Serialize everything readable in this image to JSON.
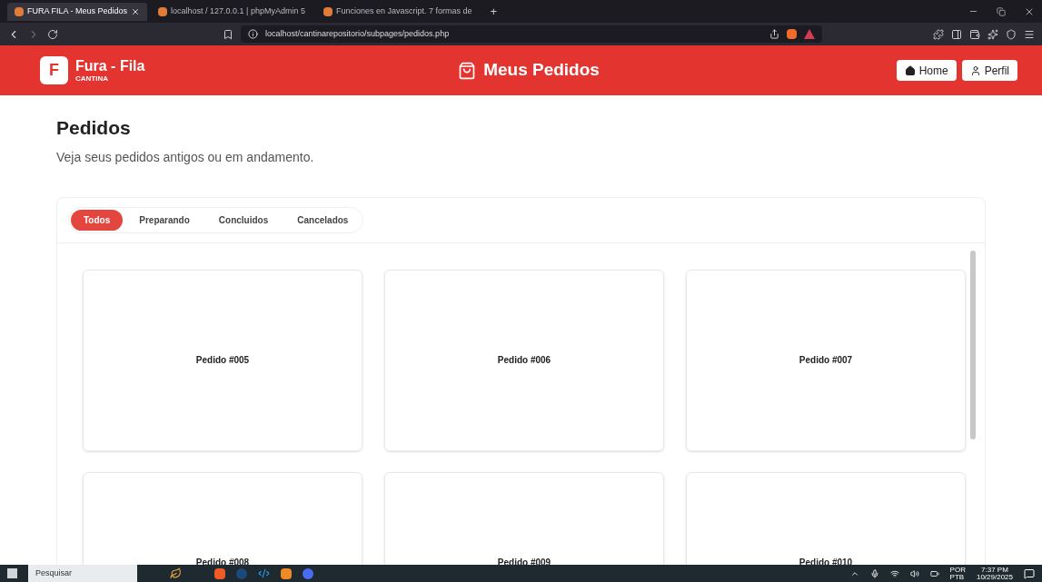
{
  "browser": {
    "tabs": [
      {
        "title": "FURA FILA - Meus Pedidos",
        "selected": true
      },
      {
        "title": "localhost / 127.0.0.1 | phpMyAdmin 5",
        "selected": false
      },
      {
        "title": "Funciones en Javascript. 7 formas de",
        "selected": false
      }
    ],
    "new_tab": "+",
    "url": "localhost/cantinarepositorio/subpages/pedidos.php"
  },
  "header": {
    "logo_letter": "F",
    "brand": "Fura - Fila",
    "subtitle": "CANTINA",
    "title": "Meus Pedidos",
    "buttons": [
      "Home",
      "Perfil"
    ]
  },
  "page": {
    "heading": "Pedidos",
    "description": "Veja seus pedidos antigos ou em andamento.",
    "filters": [
      {
        "label": "Todos",
        "selected": true
      },
      {
        "label": "Preparando",
        "selected": false
      },
      {
        "label": "Concluidos",
        "selected": false
      },
      {
        "label": "Cancelados",
        "selected": false
      }
    ],
    "orders": [
      "Pedido #005",
      "Pedido #006",
      "Pedido #007",
      "Pedido #008",
      "Pedido #009",
      "Pedido #010"
    ]
  },
  "taskbar": {
    "search": "Pesquisar",
    "language": "POR",
    "layout": "PTB",
    "time": "7:37 PM",
    "date": "10/29/2025"
  }
}
